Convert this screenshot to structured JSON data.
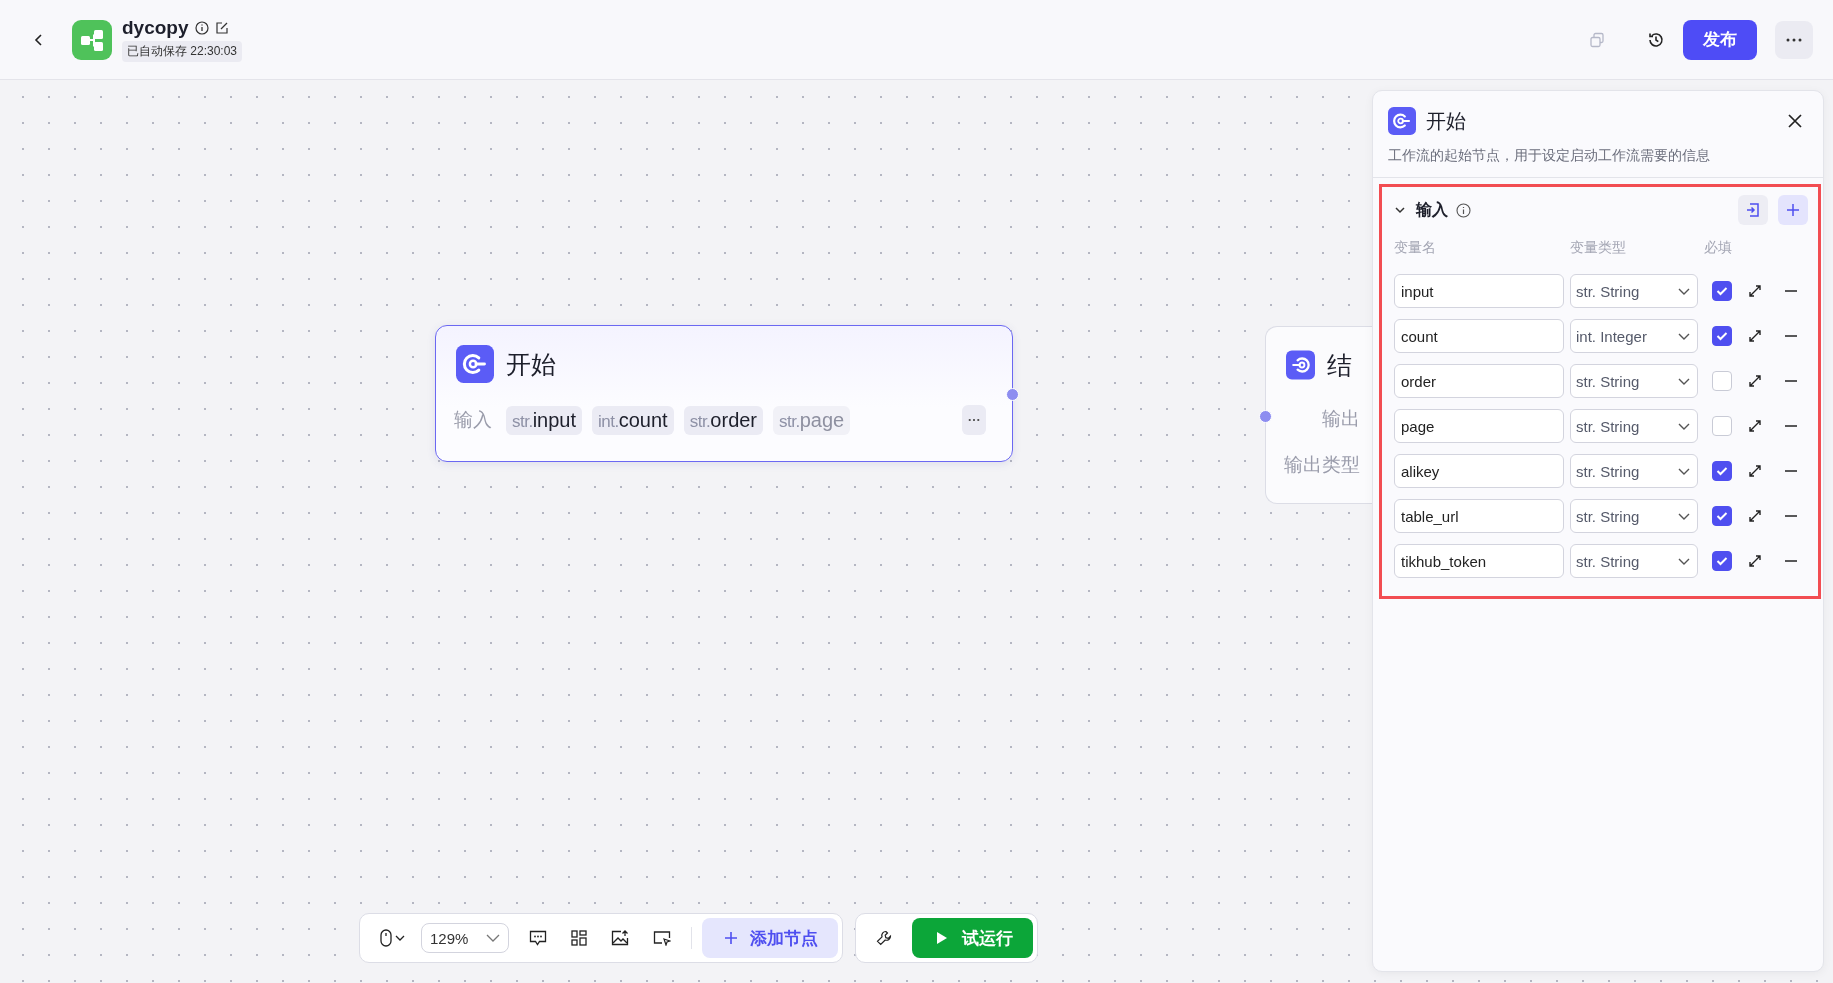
{
  "header": {
    "title": "dycopy",
    "autosave": "已自动保存 22:30:03",
    "publish": "发布"
  },
  "canvas": {
    "nodes": [
      {
        "kind": "start",
        "title": "开始",
        "input_label": "输入",
        "params": [
          {
            "type": "str.",
            "name": "input",
            "faded": false
          },
          {
            "type": "int.",
            "name": "count",
            "faded": false
          },
          {
            "type": "str.",
            "name": "order",
            "faded": false
          },
          {
            "type": "str.",
            "name": "page",
            "faded": true
          }
        ]
      },
      {
        "kind": "end",
        "title": "结",
        "rows": [
          "输出",
          "输出类型"
        ]
      }
    ]
  },
  "panel": {
    "title": "开始",
    "description": "工作流的起始节点，用于设定启动工作流需要的信息",
    "section": {
      "title": "输入",
      "expanded": true,
      "columns": [
        "变量名",
        "变量类型",
        "必填"
      ],
      "rows": [
        {
          "name": "input",
          "type": "str. String",
          "required": true
        },
        {
          "name": "count",
          "type": "int. Integer",
          "required": true
        },
        {
          "name": "order",
          "type": "str. String",
          "required": false
        },
        {
          "name": "page",
          "type": "str. String",
          "required": false
        },
        {
          "name": "alikey",
          "type": "str. String",
          "required": true
        },
        {
          "name": "table_url",
          "type": "str. String",
          "required": true
        },
        {
          "name": "tikhub_token",
          "type": "str. String",
          "required": true
        }
      ]
    }
  },
  "toolbar": {
    "zoom": "129%",
    "add_node": "添加节点",
    "run": "试运行"
  }
}
